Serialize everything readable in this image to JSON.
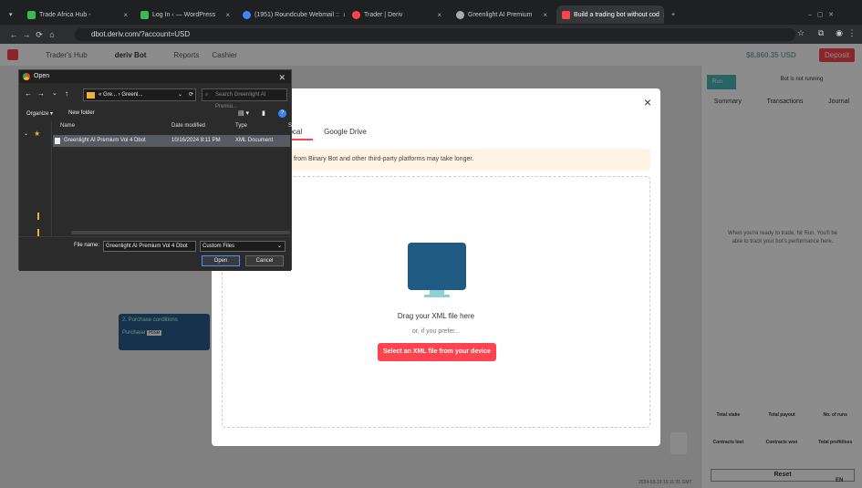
{
  "browser": {
    "tabs": [
      {
        "label": "Trade Africa Hub -",
        "color": "#3cba54"
      },
      {
        "label": "Log In ‹ — WordPress",
        "color": "#3cba54"
      },
      {
        "label": "(1951) Roundcube Webmail :: ",
        "color": "#4285f4"
      },
      {
        "label": "Trader | Deriv",
        "color": "#ff444f"
      },
      {
        "label": "Greenlight AI Premium",
        "color": "#aaaaaa"
      },
      {
        "label": "Build a trading bot without cod",
        "color": "#ff444f"
      }
    ],
    "url": "dbot.deriv.com/?account=USD"
  },
  "app": {
    "header_items": [
      "Trader's Hub",
      "deriv Bot",
      "Reports",
      "Cashier"
    ],
    "balance": "$8,860.35 USD",
    "deposit": "Deposit",
    "run": "Run",
    "bot_status": "Bot is not running",
    "drawer_tabs": [
      "Summary",
      "Transactions",
      "Journal"
    ],
    "drawer_msg": "When you're ready to trade, hit Run. You'll be able to track your bot's performance here.",
    "stats": [
      "Total stake",
      "Total payout",
      "No. of runs",
      "Contracts lost",
      "Contracts won",
      "Total profit/loss"
    ],
    "reset": "Reset",
    "block_label": "2. Purchase conditions",
    "purchase_label": "Purchase",
    "purchase_value": "Rise",
    "language": "EN",
    "timestamp": "2024-03-19 19:11:31 GMT"
  },
  "modal": {
    "tabs": [
      "Local",
      "Google Drive"
    ],
    "notice": "from Binary Bot and other third-party platforms may take longer.",
    "drop_title": "Drag your XML file here",
    "drop_or": "or, if you prefer...",
    "select_button": "Select an XML file from your device"
  },
  "dialog": {
    "title": "Open",
    "path": "« Gre... › Greenl...",
    "search_placeholder": "Search Greenlight AI Premiu...",
    "organize": "Organize ▾",
    "new_folder": "New folder",
    "columns": [
      "Name",
      "Date modified",
      "Type",
      "S"
    ],
    "file": {
      "name": "Greenlight AI Premium Vol 4 Dbot",
      "date": "10/16/2024 8:11 PM",
      "type": "XML Document"
    },
    "file_name_label": "File name:",
    "file_name_value": "Greenlight AI Premium Vol 4 Dbot",
    "file_type": "Custom Files",
    "open": "Open",
    "cancel": "Cancel"
  },
  "colors": {
    "accent": "#ff444f",
    "brand_blue": "#1e5a82",
    "notice_bg": "#fff3e3"
  }
}
